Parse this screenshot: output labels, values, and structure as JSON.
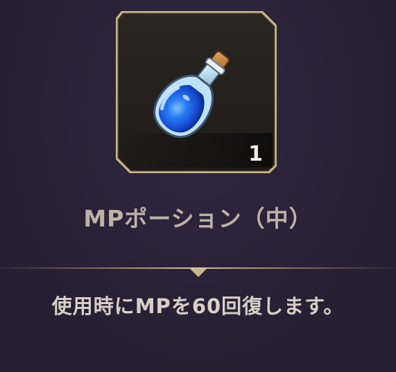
{
  "item": {
    "icon": "blue-mp-potion-icon",
    "count": "1",
    "name": "MPポーション（中）",
    "description": "使用時にMPを60回復します。"
  },
  "colors": {
    "background": "#2a2338",
    "frame_border": "#c9b58a",
    "frame_fill": "#24211e",
    "name_text": "#bcb3a8",
    "description_text": "#d6d0c6",
    "divider_gold": "#b8a77a",
    "potion_liquid": "#1f6ff0"
  }
}
